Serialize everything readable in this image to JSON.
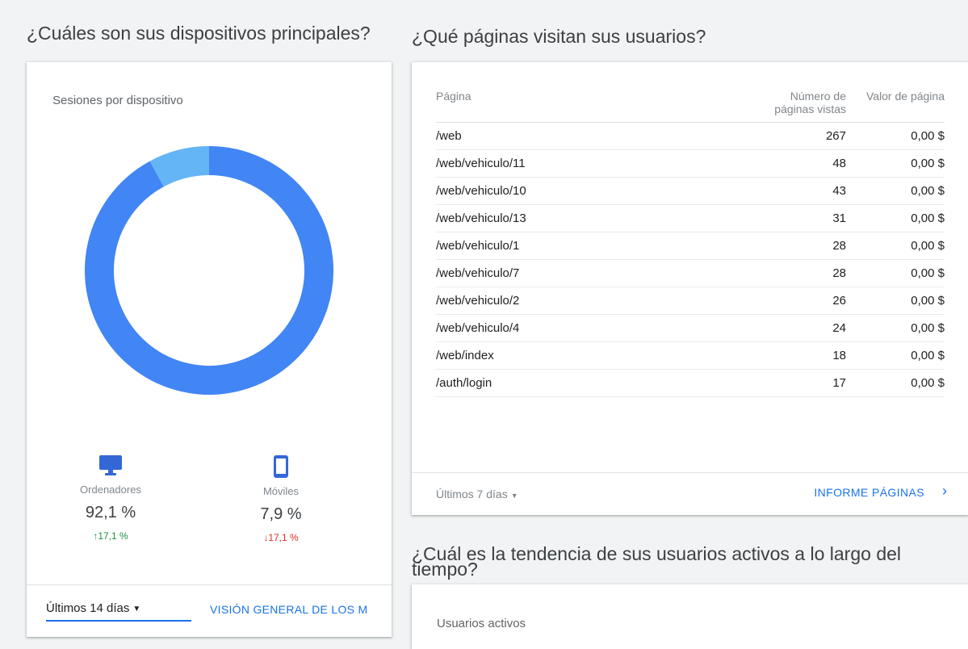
{
  "devices_section": {
    "heading": "¿Cuáles son sus dispositivos principales?",
    "card_title": "Sesiones por dispositivo",
    "chart_data": {
      "type": "pie",
      "title": "Sesiones por dispositivo",
      "categories": [
        "Ordenadores",
        "Móviles"
      ],
      "values": [
        92.1,
        7.9
      ],
      "colors": [
        "#4285f4",
        "#64b5f6"
      ]
    },
    "stats": [
      {
        "icon": "desktop-icon",
        "label": "Ordenadores",
        "percent": "92,1 %",
        "change": "↑17,1 %",
        "direction": "up"
      },
      {
        "icon": "phone-icon",
        "label": "Móviles",
        "percent": "7,9 %",
        "change": "↓17,1 %",
        "direction": "down"
      }
    ],
    "footer": {
      "range": "Últimos 14 días",
      "link": "VISIÓN GENERAL DE LOS M"
    }
  },
  "pages_section": {
    "heading": "¿Qué páginas visitan sus usuarios?",
    "columns": {
      "page": "Página",
      "views": "Número de páginas vistas",
      "value": "Valor de página"
    },
    "rows": [
      {
        "page": "/web",
        "views": "267",
        "value": "0,00 $"
      },
      {
        "page": "/web/vehiculo/11",
        "views": "48",
        "value": "0,00 $"
      },
      {
        "page": "/web/vehiculo/10",
        "views": "43",
        "value": "0,00 $"
      },
      {
        "page": "/web/vehiculo/13",
        "views": "31",
        "value": "0,00 $"
      },
      {
        "page": "/web/vehiculo/1",
        "views": "28",
        "value": "0,00 $"
      },
      {
        "page": "/web/vehiculo/7",
        "views": "28",
        "value": "0,00 $"
      },
      {
        "page": "/web/vehiculo/2",
        "views": "26",
        "value": "0,00 $"
      },
      {
        "page": "/web/vehiculo/4",
        "views": "24",
        "value": "0,00 $"
      },
      {
        "page": "/web/index",
        "views": "18",
        "value": "0,00 $"
      },
      {
        "page": "/auth/login",
        "views": "17",
        "value": "0,00 $"
      }
    ],
    "footer": {
      "range": "Últimos 7 días",
      "link": "INFORME PÁGINAS"
    }
  },
  "trend_section": {
    "heading": "¿Cuál es la tendencia de sus usuarios activos a lo largo del tiempo?",
    "card_title": "Usuarios activos"
  }
}
